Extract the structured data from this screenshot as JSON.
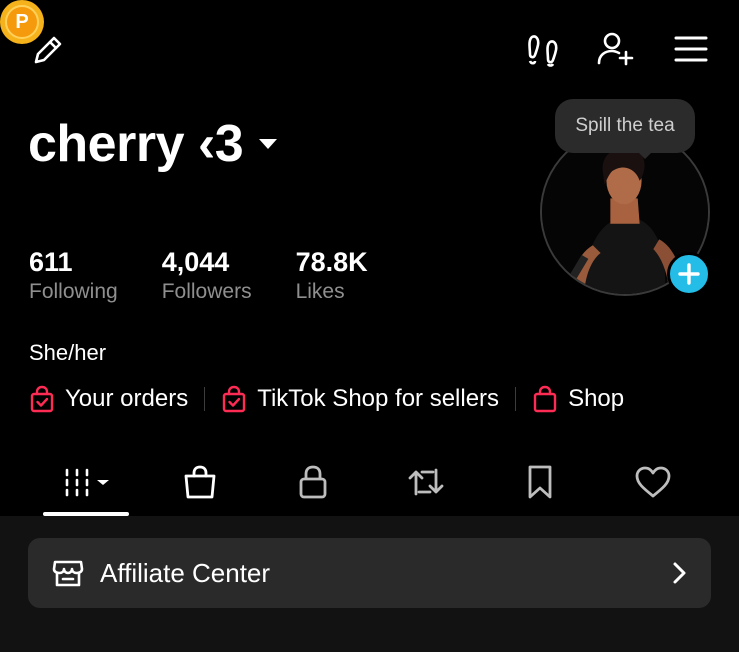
{
  "profile": {
    "name": "cherry ‹3",
    "tooltip": "Spill the tea",
    "bio": "She/her"
  },
  "points_badge": {
    "letter": "P"
  },
  "stats": [
    {
      "value": "611",
      "label": "Following"
    },
    {
      "value": "4,044",
      "label": "Followers"
    },
    {
      "value": "78.8K",
      "label": "Likes"
    }
  ],
  "links": [
    {
      "label": "Your orders",
      "icon": "shopping-bag-check-icon"
    },
    {
      "label": "TikTok Shop for sellers",
      "icon": "shopping-bag-check-icon"
    },
    {
      "label": "Shop",
      "icon": "shopping-bag-icon"
    }
  ],
  "tabs": [
    {
      "icon": "videos-grid-icon",
      "active": true
    },
    {
      "icon": "shop-bag-icon",
      "active": false
    },
    {
      "icon": "lock-icon",
      "active": false
    },
    {
      "icon": "repost-icon",
      "active": false
    },
    {
      "icon": "bookmark-icon",
      "active": false
    },
    {
      "icon": "heart-icon",
      "active": false
    }
  ],
  "affiliate": {
    "label": "Affiliate Center"
  },
  "colors": {
    "background": "#000000",
    "accent_add": "#23bde8",
    "shop_red": "#fe2c55",
    "points_gold": "#f6b21a",
    "card_bg": "#2a2a2a"
  }
}
